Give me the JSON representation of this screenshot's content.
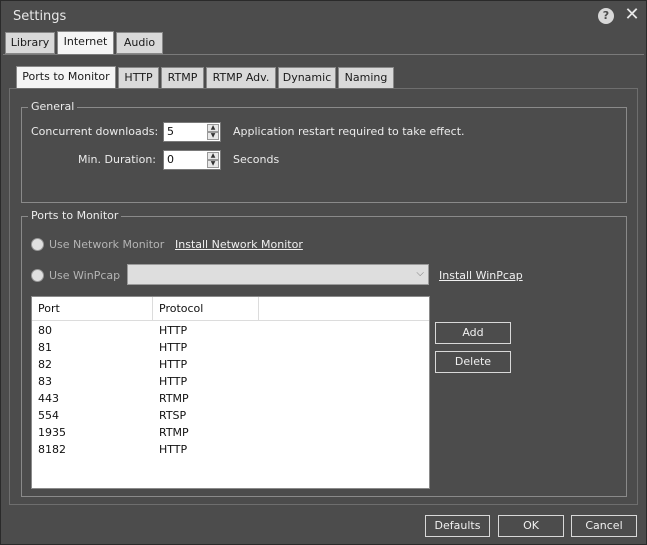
{
  "window": {
    "title": "Settings"
  },
  "top_tabs": [
    "Library",
    "Internet",
    "Audio"
  ],
  "sub_tabs": [
    "Ports to Monitor",
    "HTTP",
    "RTMP",
    "RTMP Adv.",
    "Dynamic",
    "Naming"
  ],
  "general": {
    "legend": "General",
    "concurrent_label": "Concurrent downloads:",
    "concurrent_value": "5",
    "concurrent_note": "Application restart required to take effect.",
    "duration_label": "Min. Duration:",
    "duration_value": "0",
    "duration_unit": "Seconds"
  },
  "ports": {
    "legend": "Ports to Monitor",
    "network_monitor_label": "Use Network Monitor",
    "install_network_monitor": "Install Network Monitor",
    "winpcap_label": "Use WinPcap",
    "install_winpcap": "Install WinPcap",
    "columns": [
      "Port",
      "Protocol"
    ],
    "rows": [
      {
        "port": "80",
        "protocol": "HTTP"
      },
      {
        "port": "81",
        "protocol": "HTTP"
      },
      {
        "port": "82",
        "protocol": "HTTP"
      },
      {
        "port": "83",
        "protocol": "HTTP"
      },
      {
        "port": "443",
        "protocol": "RTMP"
      },
      {
        "port": "554",
        "protocol": "RTSP"
      },
      {
        "port": "1935",
        "protocol": "RTMP"
      },
      {
        "port": "8182",
        "protocol": "HTTP"
      }
    ],
    "add_label": "Add",
    "delete_label": "Delete"
  },
  "footer": {
    "defaults_label": "Defaults",
    "ok_label": "OK",
    "cancel_label": "Cancel"
  },
  "icons": {
    "help": "help-icon",
    "close": "close-icon"
  }
}
